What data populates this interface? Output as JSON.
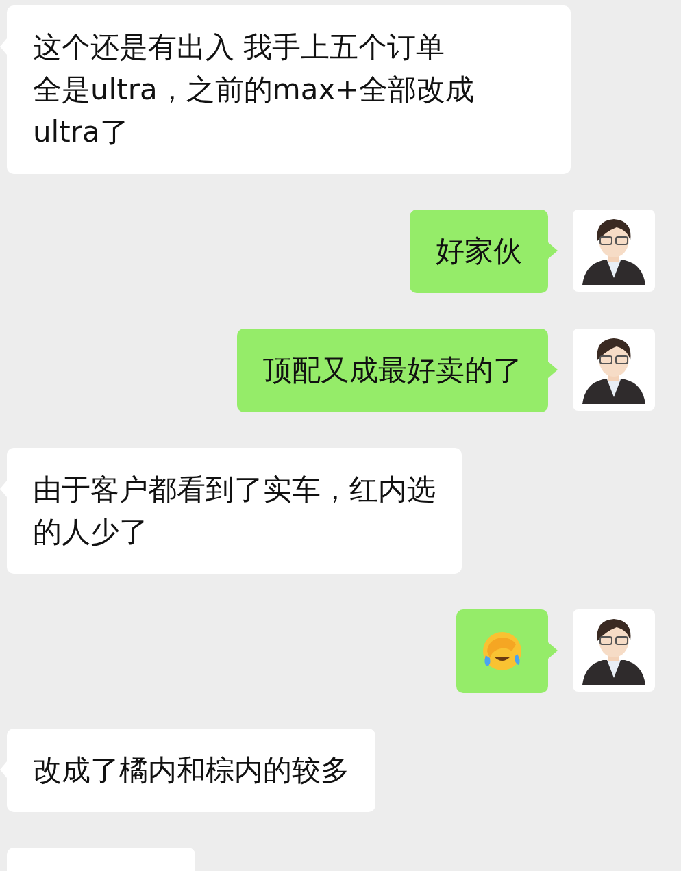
{
  "messages": [
    {
      "outgoing": false,
      "kind": "text",
      "lines": [
        "这个还是有出入 我手上五个订单",
        "全是ultra，之前的max+全部改成",
        "ultra了"
      ]
    },
    {
      "outgoing": true,
      "kind": "text",
      "lines": [
        "好家伙"
      ]
    },
    {
      "outgoing": true,
      "kind": "text",
      "lines": [
        "顶配又成最好卖的了"
      ]
    },
    {
      "outgoing": false,
      "kind": "text",
      "lines": [
        "由于客户都看到了实车，红内选",
        "的人少了"
      ]
    },
    {
      "outgoing": true,
      "kind": "emoji"
    },
    {
      "outgoing": false,
      "kind": "text",
      "lines": [
        "改成了橘内和棕内的较多"
      ]
    },
    {
      "outgoing": false,
      "kind": "cut"
    }
  ]
}
